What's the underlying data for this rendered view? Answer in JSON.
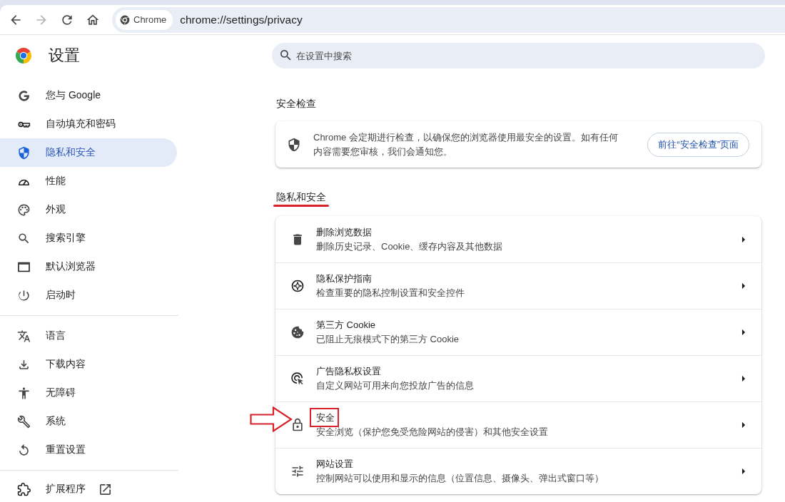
{
  "toolbar": {
    "nav_buttons": [
      {
        "kind": "back",
        "disabled": false
      },
      {
        "kind": "forward",
        "disabled": true
      },
      {
        "kind": "reload",
        "disabled": false
      },
      {
        "kind": "home",
        "disabled": false
      }
    ],
    "omnibox": {
      "chip": "Chrome",
      "url": "chrome://settings/privacy"
    }
  },
  "header": {
    "title": "设置",
    "search": {
      "placeholder": "在设置中搜索"
    }
  },
  "sidebar": {
    "groups": [
      {
        "items": [
          {
            "kind": "google",
            "label": "您与 Google",
            "selected": false,
            "external": false
          },
          {
            "kind": "autofill",
            "label": "自动填充和密码",
            "selected": false,
            "external": false
          },
          {
            "kind": "privacy",
            "label": "隐私和安全",
            "selected": true,
            "external": false
          },
          {
            "kind": "performance",
            "label": "性能",
            "selected": false,
            "external": false
          },
          {
            "kind": "appearance",
            "label": "外观",
            "selected": false,
            "external": false
          },
          {
            "kind": "search",
            "label": "搜索引擎",
            "selected": false,
            "external": false
          },
          {
            "kind": "default-browser",
            "label": "默认浏览器",
            "selected": false,
            "external": false
          },
          {
            "kind": "startup",
            "label": "启动时",
            "selected": false,
            "external": false
          }
        ]
      },
      {
        "items": [
          {
            "kind": "languages",
            "label": "语言",
            "selected": false,
            "external": false
          },
          {
            "kind": "downloads",
            "label": "下载内容",
            "selected": false,
            "external": false
          },
          {
            "kind": "accessibility",
            "label": "无障碍",
            "selected": false,
            "external": false
          },
          {
            "kind": "system",
            "label": "系统",
            "selected": false,
            "external": false
          },
          {
            "kind": "reset",
            "label": "重置设置",
            "selected": false,
            "external": false
          }
        ]
      },
      {
        "items": [
          {
            "kind": "extensions",
            "label": "扩展程序",
            "selected": false,
            "external": true
          }
        ]
      }
    ]
  },
  "safety_check": {
    "heading": "安全检查",
    "description": "Chrome 会定期进行检查，以确保您的浏览器使用最安全的设置。如有任何内容需要您审核，我们会通知您。",
    "button": "前往“安全检查”页面"
  },
  "privacy": {
    "heading": "隐私和安全",
    "underlined": true,
    "rows": [
      {
        "kind": "trash",
        "title": "删除浏览数据",
        "subtitle": "删除历史记录、Cookie、缓存内容及其他数据",
        "highlighted": false
      },
      {
        "kind": "guide",
        "title": "隐私保护指南",
        "subtitle": "检查重要的隐私控制设置和安全控件",
        "highlighted": false
      },
      {
        "kind": "cookie",
        "title": "第三方 Cookie",
        "subtitle": "已阻止无痕模式下的第三方 Cookie",
        "highlighted": false
      },
      {
        "kind": "ads",
        "title": "广告隐私权设置",
        "subtitle": "自定义网站可用来向您投放广告的信息",
        "highlighted": false
      },
      {
        "kind": "security",
        "title": "安全",
        "subtitle": "安全浏览（保护您免受危险网站的侵害）和其他安全设置",
        "highlighted": true
      },
      {
        "kind": "site-settings",
        "title": "网站设置",
        "subtitle": "控制网站可以使用和显示的信息（位置信息、摄像头、弹出式窗口等）",
        "highlighted": false
      }
    ]
  }
}
